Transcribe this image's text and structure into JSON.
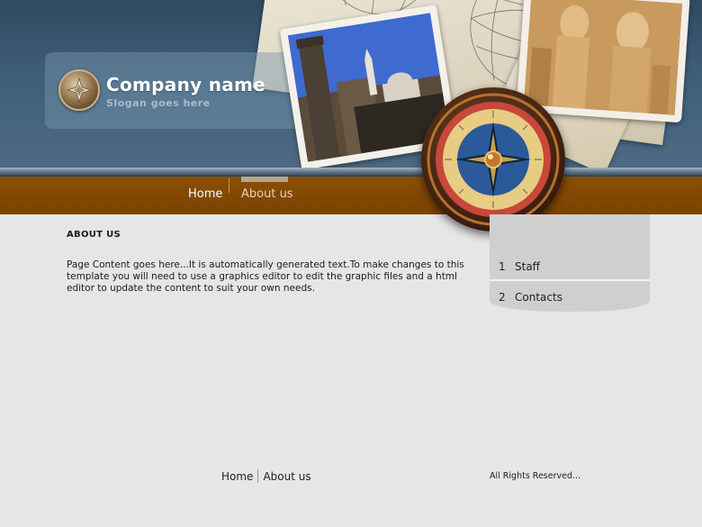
{
  "header": {
    "company_name": "Company name",
    "slogan": "Slogan goes here"
  },
  "nav": {
    "items": [
      {
        "label": "Home",
        "active": false
      },
      {
        "label": "About us",
        "active": true
      }
    ]
  },
  "content": {
    "title": "ABOUT US",
    "body": "Page Content goes here...It is automatically generated text.To make changes to this template you will need to use a graphics editor to edit the graphic files and a html editor to update the content to suit your own needs."
  },
  "sidebar": {
    "items": [
      {
        "number": "1",
        "label": "Staff"
      },
      {
        "number": "2",
        "label": "Contacts"
      }
    ]
  },
  "footer": {
    "links": [
      "Home",
      "About us"
    ],
    "copyright": "All Rights Reserved..."
  },
  "colors": {
    "header_blue": "#3f5e79",
    "nav_brown": "#7a4300",
    "page_bg": "#e6e6e6",
    "sidebar_bg": "#cfcfcf"
  }
}
